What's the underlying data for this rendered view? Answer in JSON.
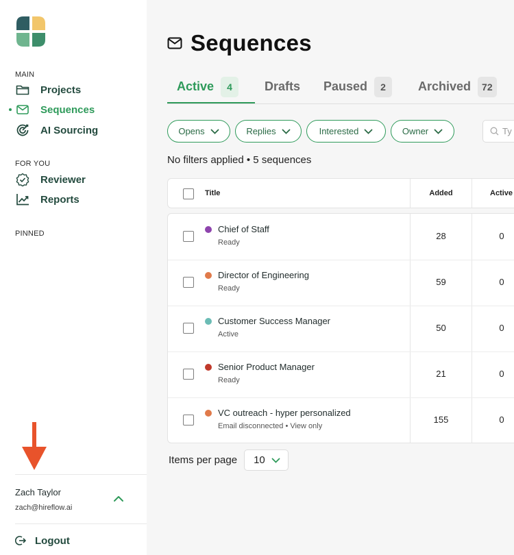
{
  "sidebar": {
    "main_label": "MAIN",
    "for_you_label": "FOR YOU",
    "pinned_label": "PINNED",
    "items": [
      {
        "label": "Projects",
        "icon": "folder-icon"
      },
      {
        "label": "Sequences",
        "icon": "mail-icon",
        "active": true
      },
      {
        "label": "AI Sourcing",
        "icon": "ai-sourcing-icon"
      },
      {
        "label": "Reviewer",
        "icon": "badge-check-icon"
      },
      {
        "label": "Reports",
        "icon": "chart-icon"
      }
    ],
    "user": {
      "name": "Zach Taylor",
      "email": "zach@hireflow.ai"
    },
    "logout_label": "Logout"
  },
  "header": {
    "title": "Sequences",
    "icon": "mail-icon"
  },
  "tabs": [
    {
      "label": "Active",
      "count": "4",
      "active": true
    },
    {
      "label": "Drafts",
      "count": ""
    },
    {
      "label": "Paused",
      "count": "2"
    },
    {
      "label": "Archived",
      "count": "72"
    }
  ],
  "filters": [
    {
      "label": "Opens"
    },
    {
      "label": "Replies"
    },
    {
      "label": "Interested"
    },
    {
      "label": "Owner"
    }
  ],
  "search": {
    "placeholder": "Ty"
  },
  "filter_summary": "No filters applied • 5 sequences",
  "table": {
    "columns": [
      "Title",
      "Added",
      "Active"
    ],
    "rows": [
      {
        "title": "Chief of Staff",
        "status": "Ready",
        "added": "28",
        "active": "0",
        "color": "#8e44ad"
      },
      {
        "title": "Director of Engineering",
        "status": "Ready",
        "added": "59",
        "active": "0",
        "color": "#e07a4a"
      },
      {
        "title": "Customer Success Manager",
        "status": "Active",
        "added": "50",
        "active": "0",
        "color": "#6bbcb5"
      },
      {
        "title": "Senior Product Manager",
        "status": "Ready",
        "added": "21",
        "active": "0",
        "color": "#c0392b"
      },
      {
        "title": "VC outreach - hyper personalized",
        "status": "Email disconnected • View only",
        "added": "155",
        "active": "0",
        "color": "#e07a4a"
      }
    ]
  },
  "pagination": {
    "label": "Items per page",
    "value": "10"
  },
  "colors": {
    "accent": "#2e9a5a",
    "arrow": "#e8532b",
    "brand_dark": "#234a3e"
  }
}
